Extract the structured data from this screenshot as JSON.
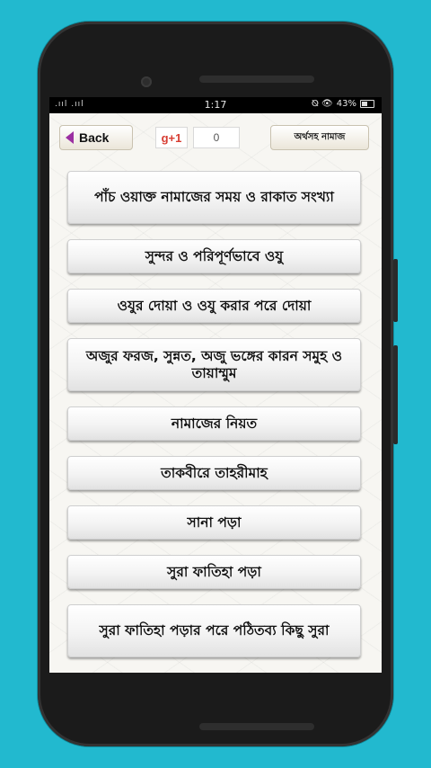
{
  "statusbar": {
    "signal": ".ııl .ııl",
    "time": "1:17",
    "icons": "⦰ 👁",
    "battery_percent": "43%"
  },
  "toolbar": {
    "back_label": "Back",
    "gplus_label": "g+1",
    "gplus_count": "0",
    "right_button_label": "অর্থসহ নামাজ"
  },
  "menu": {
    "items": [
      {
        "label": "পাঁচ ওয়াক্ত নামাজের সময় ও রাকাত সংখ্যা"
      },
      {
        "label": "সুন্দর ও পরিপূর্ণভাবে ওযু"
      },
      {
        "label": "ওযুর দোয়া ও ওযু করার পরে দোয়া"
      },
      {
        "label": "অজুর ফরজ, সুন্নত, অজু ভঙ্গের কারন সমুহ ও তায়াম্মুম"
      },
      {
        "label": "নামাজের নিয়ত"
      },
      {
        "label": "তাকবীরে তাহরীমাহ"
      },
      {
        "label": "সানা পড়া"
      },
      {
        "label": "সুরা ফাতিহা পড়া"
      },
      {
        "label": "সুরা ফাতিহা পড়ার পরে পঠিতব্য কিছু সুরা"
      }
    ]
  }
}
